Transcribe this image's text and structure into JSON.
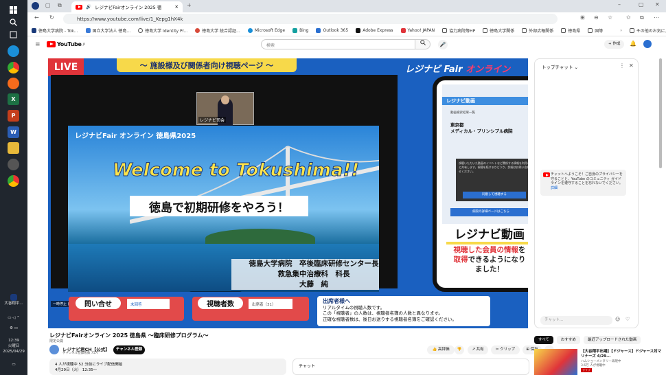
{
  "taskbar": {
    "user_label": "大谷翔平...",
    "time": "12:39",
    "weekday": "火曜日",
    "date": "2025/04/29"
  },
  "browser": {
    "tab_title": "レジナビFairオンライン 2025 徳",
    "url": "https://www.youtube.com/live/1_Kepg1hX4k",
    "bookmarks": [
      "徳島大学病院 - Tok...",
      "国立大学法人 徳島...",
      "徳島大学 Identity Pr...",
      "徳島大学 統合認証...",
      "Microsoft Edge",
      "Bing",
      "Outlook 365",
      "Adobe Express",
      "Yahoo! JAPAN",
      "協力病院等HP",
      "徳島大学関係",
      "外部広報関係",
      "徳島県",
      "国等"
    ],
    "other_bookmarks": "その他のお気に入り"
  },
  "youtube": {
    "logo": "YouTube",
    "logo_region": "JP",
    "search_placeholder": "検索",
    "create_label": "作成"
  },
  "player": {
    "live_badge": "LIVE",
    "facility_banner": "～ 施設様及び関係者向け視聴ページ ～",
    "logo_title": "レジナビ Fair",
    "logo_online": "オンライン",
    "pip_caption": "レジナビ司会",
    "slide_title": "レジナビFair オンライン 徳島県2025",
    "welcome": "Welcome to Tokushima!!",
    "catchphrase": "徳島で初期研修をやろう！",
    "speaker_lines": [
      "徳島大学病院　卒後臨床研修センター長",
      "救急集中治療科　科長",
      "大藤　純"
    ],
    "phone_header": "レジナビ動画",
    "phone_breadcrumb": "動画検索結果一覧",
    "phone_region": "東京都",
    "phone_hospital": "メディカル・プリンシプル病院",
    "phone_dialog_text": "視聴いただいた動画のイベントなど関係する情報を利用者と共有します。視聴を続けるかどうか、詳細はお問い合わせください。",
    "phone_dialog_button": "同意して視聴する",
    "phone_detail_button": "病院の詳細ページはこちら",
    "phone_video_title": "レジナビ動画",
    "phone_msg_red1": "視聴した会員の情報",
    "phone_msg_1": "を",
    "phone_msg_red2": "取得",
    "phone_msg_2": "できるようになり",
    "phone_msg_3": "ました！",
    "pause_label": "一時停止 (k)",
    "inquiry_label": "問い合せ",
    "inquiry_value": "未回答",
    "viewers_label": "視聴者数",
    "viewers_value": "出席者（31）",
    "notice_title": "出席者様へ",
    "notice_lines": [
      "リアルタイムの視聴人数です。",
      "この「視聴者」の人数は、視聴者名簿の人数と異なります。",
      "正確な視聴者数は、後日お送りする視聴者名簿をご確認ください。"
    ]
  },
  "chat": {
    "header": "トップチャット",
    "notice": "チャットへようこそ！ご自身のプライバシーを守ることと、YouTube のコミュニティ ガイドラインを遵守することを忘れないでください。",
    "notice_more": "詳細",
    "input_placeholder": "チャット..."
  },
  "video": {
    "title": "レジナビFairオンライン 2025 徳島県 ～臨床研修プログラム～",
    "scope_tag": "限定公開",
    "channel_name": "レジナビ君CH【公式】",
    "channel_subs": "チャンネル登録者数 75人",
    "subscribe_label": "チャンネル登録",
    "actions": [
      "高評価",
      "",
      "共有",
      "クリップ",
      "保存",
      "⋯"
    ],
    "desc_line1": "4 人が視聴中  52 分前にライブ配信開始",
    "desc_line2": "4月29日（火） 12:35〜",
    "chat_below_label": "チャット"
  },
  "recommendations": {
    "chips": [
      "すべて",
      "おすすめ",
      "最近アップロードされた動画"
    ],
    "items": [
      {
        "title": "【大谷翔平出場】【ドジャース】ドジャース対マリナーズ 4/29...",
        "meta1": "ハムショーメンタリー再現中",
        "meta2": "3.6万 人が視聴中",
        "badge": "ライブ"
      }
    ]
  },
  "colors": {
    "yt_red": "#ff0000",
    "player_blue": "#1a60c0",
    "live_red": "#e0343a",
    "banner_yellow": "#f7d94a"
  }
}
